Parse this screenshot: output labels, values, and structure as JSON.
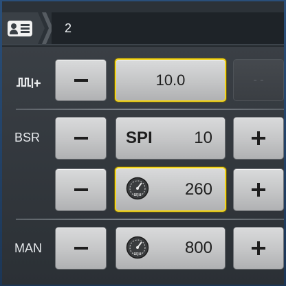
{
  "breadcrumb": {
    "icon": "id-card-icon",
    "current": "2"
  },
  "rows": {
    "pulse": {
      "icon": "pulse-wave-icon",
      "minus": "−",
      "value": "10.0",
      "disabled_text": "- -"
    },
    "bsr": {
      "label": "BSR",
      "spi": {
        "minus": "−",
        "label": "SPI",
        "value": "10",
        "plus": "+"
      },
      "rpm": {
        "minus": "−",
        "icon": "rpm-gauge-icon",
        "gauge_text": "RPM",
        "value": "260",
        "plus": "+"
      }
    },
    "man": {
      "label": "MAN",
      "minus": "−",
      "icon": "rpm-gauge-icon",
      "gauge_text": "RPM",
      "value": "800",
      "plus": "+"
    }
  },
  "colors": {
    "selected_border": "#f2d41c",
    "frame": "#2a4f7a"
  }
}
